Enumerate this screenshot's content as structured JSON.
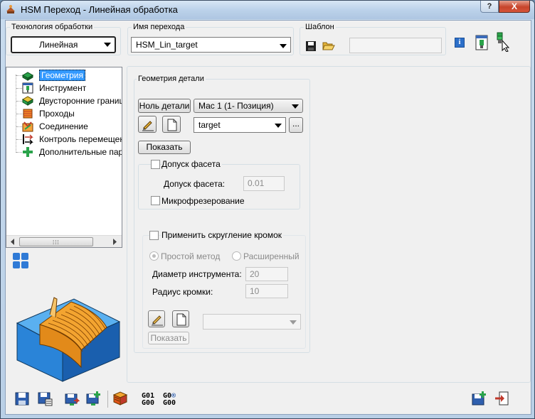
{
  "window": {
    "title": "HSM Переход - Линейная обработка",
    "help_label": "?",
    "close_label": "X"
  },
  "header": {
    "technology_group_label": "Технология обработки",
    "technology_value": "Линейная",
    "operation_name_label": "Имя перехода",
    "operation_name_value": "HSM_Lin_target",
    "template_label": "Шаблон",
    "template_value": ""
  },
  "tree": {
    "items": [
      {
        "label": "Геометрия",
        "selected": true,
        "icon": "geometry-icon"
      },
      {
        "label": "Инструмент",
        "icon": "tool-icon"
      },
      {
        "label": "Двусторонние границы",
        "icon": "boundaries-icon"
      },
      {
        "label": "Проходы",
        "icon": "passes-icon"
      },
      {
        "label": "Соединение",
        "icon": "link-icon"
      },
      {
        "label": "Контроль перемещений",
        "icon": "motion-control-icon"
      },
      {
        "label": "Дополнительные параметры",
        "icon": "add-params-icon"
      }
    ]
  },
  "geometry": {
    "group_label": "Геометрия детали",
    "part_zero_button": "Ноль детали",
    "mac_value": "Мас 1 (1- Позиция)",
    "target_value": "target",
    "browse_label": "...",
    "show_button": "Показать",
    "facet_tolerance_check_label": "Допуск фасета",
    "facet_tolerance_label": "Допуск фасета:",
    "facet_tolerance_value": "0.01",
    "micro_milling_label": "Микрофрезерование",
    "edge_rounding_check_label": "Применить скругление кромок",
    "simple_method_label": "Простой метод",
    "extended_label": "Расширенный",
    "tool_diameter_label": "Диаметр инструмента:",
    "tool_diameter_value": "20",
    "edge_radius_label": "Радиус кромки:",
    "edge_radius_value": "10",
    "show_button_2": "Показать"
  },
  "toolbar": {
    "gcode1_line1": "G01",
    "gcode1_line2": "G00",
    "gcode2_line1": "G0",
    "gcode2_line2": "G00"
  },
  "colors": {
    "accent": "#3399ff",
    "title_bar": "#bcd2ea",
    "close_red": "#c7442b"
  }
}
